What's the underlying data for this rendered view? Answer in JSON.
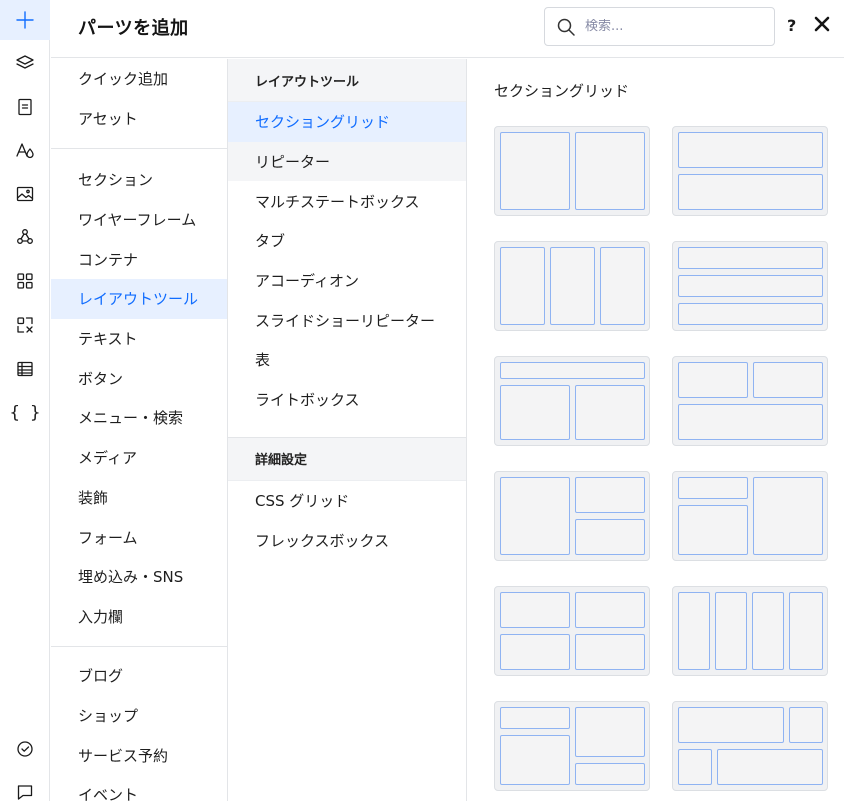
{
  "rail": {
    "items": [
      {
        "icon": "add-icon",
        "active": true
      },
      {
        "icon": "layers-icon"
      },
      {
        "icon": "pages-icon"
      },
      {
        "icon": "design-fonts-icon"
      },
      {
        "icon": "media-image-icon"
      },
      {
        "icon": "apps-integrations-icon"
      },
      {
        "icon": "app-market-icon"
      },
      {
        "icon": "business-apps-icon"
      },
      {
        "icon": "cms-table-icon"
      },
      {
        "icon": "code-braces-icon",
        "glyph": "{ }"
      },
      {
        "icon": "site-checklist-icon"
      },
      {
        "icon": "chat-icon"
      }
    ]
  },
  "header": {
    "title": "パーツを追加",
    "search_placeholder": "検索...",
    "help_label": "?",
    "close_icon": "close-icon"
  },
  "categories": {
    "group1": [
      "クイック追加",
      "アセット"
    ],
    "group2": [
      "セクション",
      "ワイヤーフレーム",
      "コンテナ",
      "レイアウトツール",
      "テキスト",
      "ボタン",
      "メニュー・検索",
      "メディア",
      "装飾",
      "フォーム",
      "埋め込み・SNS",
      "入力欄"
    ],
    "group3": [
      "ブログ",
      "ショップ",
      "サービス予約",
      "イベント"
    ],
    "active": "レイアウトツール"
  },
  "subpanel": {
    "section1_title": "レイアウトツール",
    "section1_items": [
      "セクショングリッド",
      "リピーター",
      "マルチステートボックス",
      "タブ",
      "アコーディオン",
      "スライドショーリピーター",
      "表",
      "ライトボックス"
    ],
    "section2_title": "詳細設定",
    "section2_items": [
      "CSS グリッド",
      "フレックスボックス"
    ],
    "active": "セクショングリッド",
    "hover": "リピーター"
  },
  "preview": {
    "title": "セクショングリッド",
    "tiles": [
      "grid-2-columns",
      "grid-2-rows",
      "grid-3-columns",
      "grid-3-rows",
      "grid-header-and-2-columns",
      "grid-2-columns-and-footer",
      "grid-left-large-right-stacked",
      "grid-left-stacked-right-large",
      "grid-2x2",
      "grid-4-columns",
      "grid-mixed-left-offset",
      "grid-mixed-wide-top"
    ]
  },
  "colors": {
    "accent": "#116dff",
    "active_bg": "#e7f0ff",
    "cell_border": "#8fb3f2",
    "tile_bg": "#f0f1f3"
  }
}
